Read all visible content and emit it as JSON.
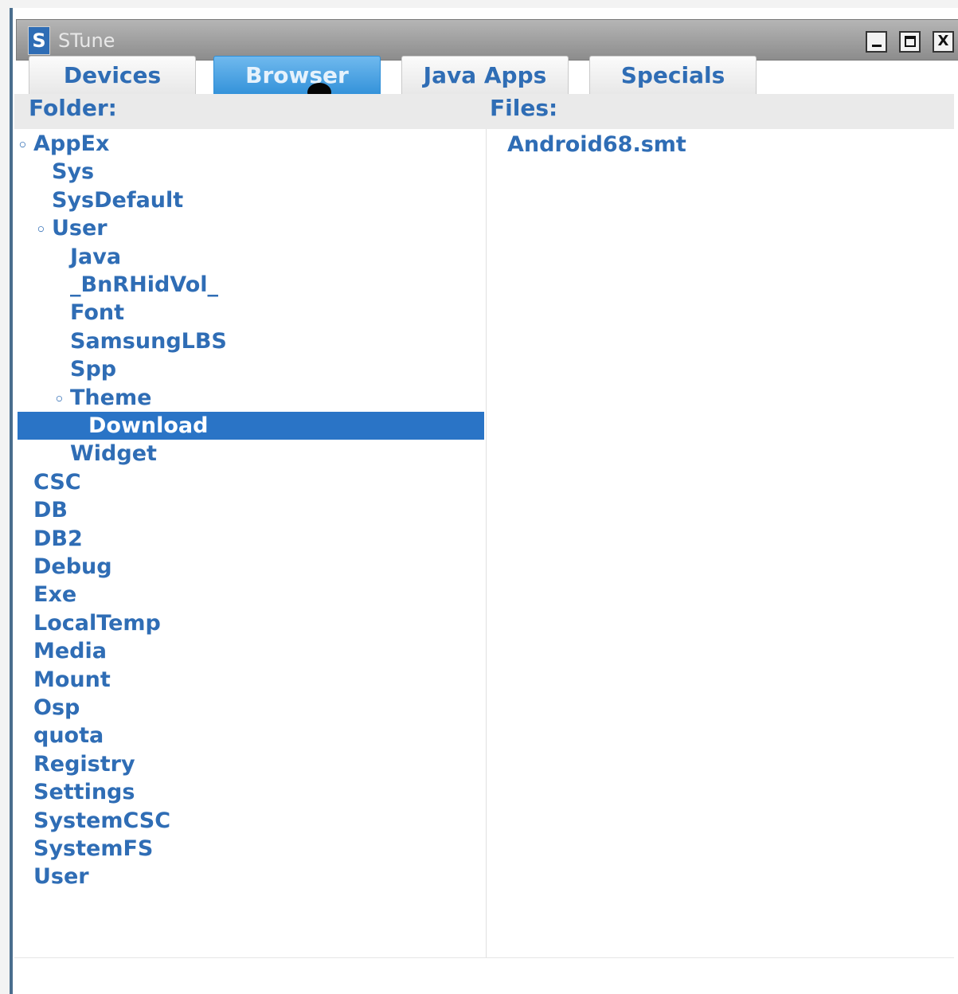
{
  "window": {
    "title": "STune",
    "logo_letter": "S",
    "min_label": "",
    "max_label": "",
    "close_label": "X"
  },
  "tabs": [
    {
      "label": "Devices",
      "active": false
    },
    {
      "label": "Browser",
      "active": true
    },
    {
      "label": "Java Apps",
      "active": false
    },
    {
      "label": "Specials",
      "active": false
    }
  ],
  "headers": {
    "folder_label": "Folder:",
    "files_label": "Files:"
  },
  "tree": [
    {
      "label": "AppEx",
      "indent": 0,
      "expanded": true
    },
    {
      "label": "Sys",
      "indent": 1
    },
    {
      "label": "SysDefault",
      "indent": 1
    },
    {
      "label": "User",
      "indent": 1,
      "expanded": true
    },
    {
      "label": "Java",
      "indent": 2
    },
    {
      "label": "_BnRHidVol_",
      "indent": 2
    },
    {
      "label": "Font",
      "indent": 2
    },
    {
      "label": "SamsungLBS",
      "indent": 2
    },
    {
      "label": "Spp",
      "indent": 2
    },
    {
      "label": "Theme",
      "indent": 2,
      "expanded": true
    },
    {
      "label": "Download",
      "indent": 3,
      "selected": true
    },
    {
      "label": "Widget",
      "indent": 2
    },
    {
      "label": "CSC",
      "indent": 0
    },
    {
      "label": "DB",
      "indent": 0
    },
    {
      "label": "DB2",
      "indent": 0
    },
    {
      "label": "Debug",
      "indent": 0
    },
    {
      "label": "Exe",
      "indent": 0
    },
    {
      "label": "LocalTemp",
      "indent": 0
    },
    {
      "label": "Media",
      "indent": 0
    },
    {
      "label": "Mount",
      "indent": 0
    },
    {
      "label": "Osp",
      "indent": 0
    },
    {
      "label": "quota",
      "indent": 0
    },
    {
      "label": "Registry",
      "indent": 0
    },
    {
      "label": "Settings",
      "indent": 0
    },
    {
      "label": "SystemCSC",
      "indent": 0
    },
    {
      "label": "SystemFS",
      "indent": 0
    },
    {
      "label": "User",
      "indent": 0
    }
  ],
  "files": [
    {
      "name": "Android68.smt"
    }
  ],
  "colors": {
    "accent": "#2f6db5",
    "selected": "#2a74c6",
    "tab_active": "#2f8fd8"
  }
}
